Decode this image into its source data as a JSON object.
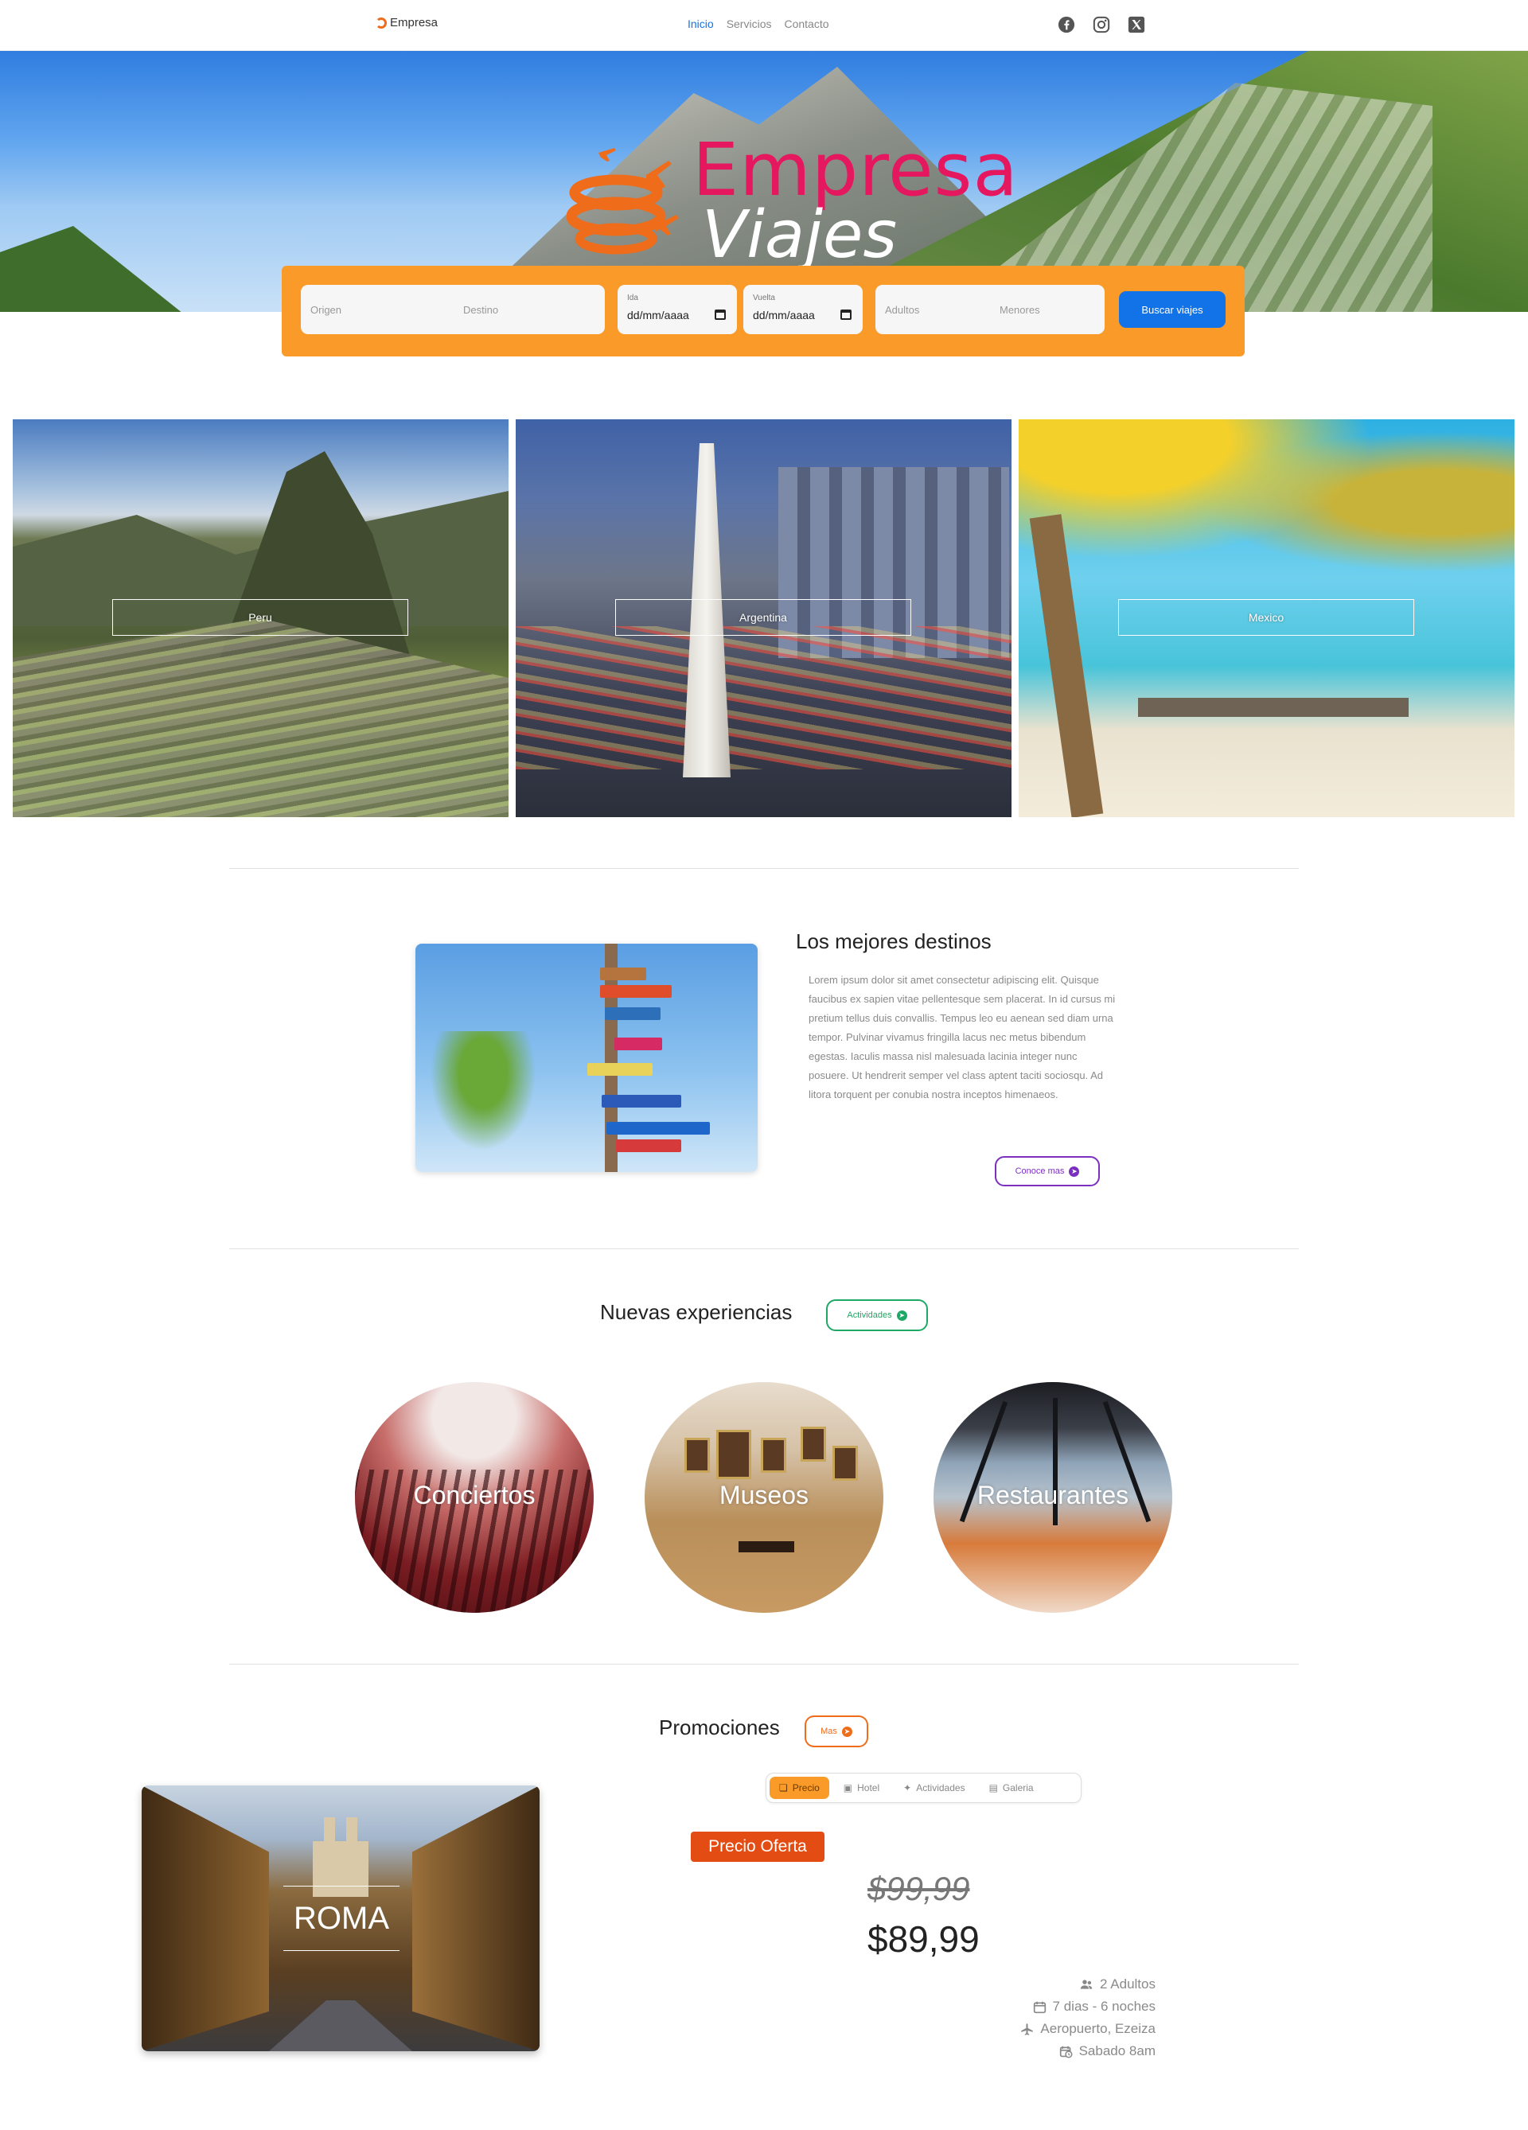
{
  "nav": {
    "brand": "Empresa",
    "links": [
      {
        "label": "Inicio",
        "active": true
      },
      {
        "label": "Servicios",
        "active": false
      },
      {
        "label": "Contacto",
        "active": false
      }
    ],
    "social": [
      "facebook-icon",
      "instagram-icon",
      "x-twitter-icon"
    ]
  },
  "hero": {
    "logo_line1": "Empresa",
    "logo_line2": "Viajes"
  },
  "search": {
    "origin_placeholder": "Origen",
    "destination_placeholder": "Destino",
    "departure_label": "Ida",
    "departure_value": "dd/mm/aaaa",
    "return_label": "Vuelta",
    "return_value": "dd/mm/aaaa",
    "adults_placeholder": "Adultos",
    "minors_placeholder": "Menores",
    "button": "Buscar viajes"
  },
  "destinations": [
    {
      "label": "Peru"
    },
    {
      "label": "Argentina"
    },
    {
      "label": "Mexico"
    }
  ],
  "about": {
    "title": "Los mejores destinos",
    "text": "Lorem ipsum dolor sit amet consectetur adipiscing elit. Quisque faucibus ex sapien vitae pellentesque sem placerat. In id cursus mi pretium tellus duis convallis. Tempus leo eu aenean sed diam urna tempor. Pulvinar vivamus fringilla lacus nec metus bibendum egestas. Iaculis massa nisl malesuada lacinia integer nunc posuere. Ut hendrerit semper vel class aptent taciti sociosqu. Ad litora torquent per conubia nostra inceptos himenaeos.",
    "button": "Conoce mas"
  },
  "experiences": {
    "title": "Nuevas experiencias",
    "button": "Actividades",
    "items": [
      {
        "label": "Conciertos"
      },
      {
        "label": "Museos"
      },
      {
        "label": "Restaurantes"
      }
    ]
  },
  "promotions": {
    "title": "Promociones",
    "button": "Mas",
    "city": "ROMA",
    "tabs": [
      {
        "label": "Precio",
        "icon": "tag-icon",
        "active": true
      },
      {
        "label": "Hotel",
        "icon": "hotel-icon",
        "active": false
      },
      {
        "label": "Actividades",
        "icon": "person-walking-icon",
        "active": false
      },
      {
        "label": "Galeria",
        "icon": "gallery-icon",
        "active": false
      }
    ],
    "badge": "Precio Oferta",
    "old_price": "$99,99",
    "price": "$89,99",
    "details": [
      {
        "icon": "users-icon",
        "text": "2 Adultos"
      },
      {
        "icon": "calendar-icon",
        "text": "7 dias - 6 noches"
      },
      {
        "icon": "plane-icon",
        "text": "Aeropuerto, Ezeiza"
      },
      {
        "icon": "calendar-clock-icon",
        "text": "Sabado 8am"
      }
    ]
  },
  "colors": {
    "accent_blue": "#1273e8",
    "search_bar": "#f99a29",
    "brand_pink": "#e5175f",
    "brand_orange": "#ef6c1b",
    "purple": "#7b2fbf",
    "green": "#1fa865",
    "promo_orange": "#e34c12"
  }
}
